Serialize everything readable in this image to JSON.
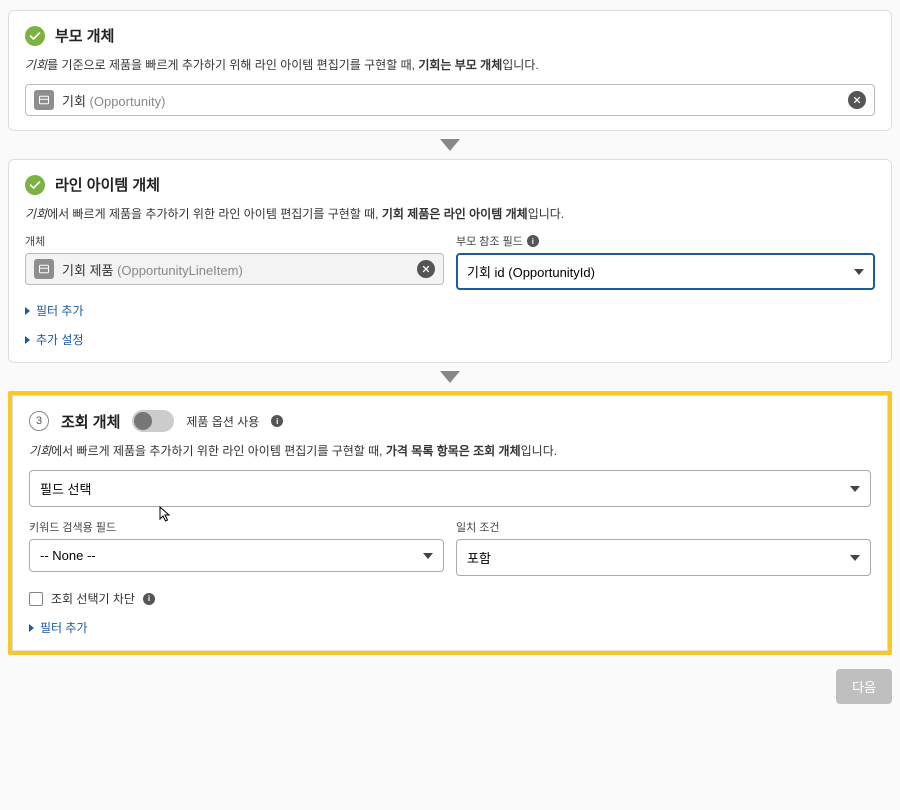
{
  "s1": {
    "title": "부모 개체",
    "desc_pre": "기회",
    "desc_mid": "를 기준으로 제품을 빠르게 추가하기 위해 라인 아이템 편집기를 구현할 때, ",
    "desc_bold": "기회는 부모 개체",
    "desc_post": "입니다.",
    "pill_label": "기회",
    "pill_api": " (Opportunity)"
  },
  "s2": {
    "title": "라인 아이템 개체",
    "desc_pre": "기회",
    "desc_mid": "에서 빠르게 제품을 추가하기 위한 라인 아이템 편집기를 구현할 때, ",
    "desc_bold": "기회 제품은 라인 아이템 개체",
    "desc_post": "입니다.",
    "obj_label": "개체",
    "pill_label": "기회 제품",
    "pill_api": " (OpportunityLineItem)",
    "parent_label": "부모 참조 필드",
    "parent_value": "기회 id (OpportunityId)",
    "link_filter": "필터 추가",
    "link_settings": "추가 설정"
  },
  "s3": {
    "step": "3",
    "title": "조회 개체",
    "toggle_label": "제품 옵션 사용",
    "desc_pre": "기회",
    "desc_mid": "에서 빠르게 제품을 추가하기 위한 라인 아이템 편집기를 구현할 때, ",
    "desc_bold": "가격 목록 항목은 조회 개체",
    "desc_post": "입니다.",
    "field_select": "필드 선택",
    "kw_label": "키워드 검색용 필드",
    "kw_value": "-- None --",
    "match_label": "일치 조건",
    "match_value": "포함",
    "block_label": "조회 선택기 차단",
    "link_filter": "필터 추가"
  },
  "footer": {
    "next": "다음"
  }
}
